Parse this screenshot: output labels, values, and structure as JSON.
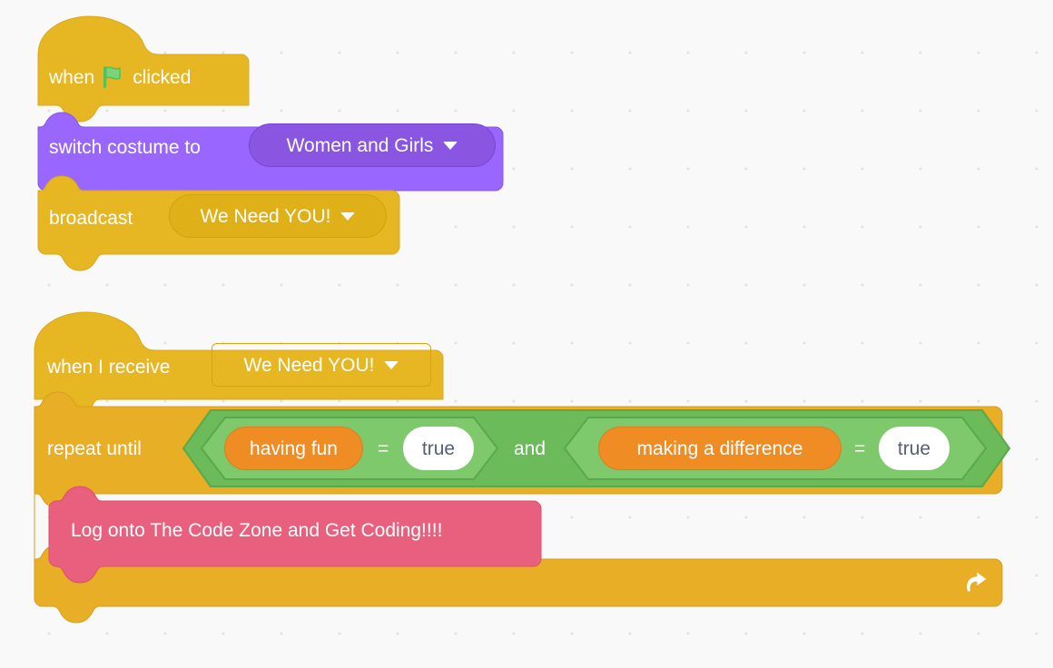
{
  "workspace": {
    "name": "scratch-block-workspace",
    "background_color": "#f9f9f9",
    "grid_dot_color": "#e3e3e6"
  },
  "palette": {
    "events_yellow": "#ffbf00",
    "events_yellow_fill": "#e6b723",
    "looks_purple": "#9966ff",
    "control_orange": "#e8ae25",
    "operators_green": "#6cbb5a",
    "operators_green_light": "#7fc96d",
    "variables_orange": "#ef8c24",
    "custom_pink": "#e8607d",
    "text_white": "#ffffff",
    "text_dark": "#575e75"
  },
  "scripts": [
    {
      "id": "script-1",
      "blocks": [
        {
          "id": "when-flag-clicked",
          "type": "hat",
          "category": "events",
          "label_before": "when",
          "icon": "green-flag-icon",
          "label_after": "clicked"
        },
        {
          "id": "switch-costume-to",
          "type": "stack",
          "category": "looks",
          "label": "switch costume to",
          "field": {
            "name": "costume-dropdown",
            "value": "Women and Girls",
            "kind": "dropdown"
          }
        },
        {
          "id": "broadcast",
          "type": "stack",
          "category": "events",
          "label": "broadcast",
          "field": {
            "name": "broadcast-message-dropdown",
            "value": "We Need YOU!",
            "kind": "dropdown"
          }
        }
      ]
    },
    {
      "id": "script-2",
      "blocks": [
        {
          "id": "when-i-receive",
          "type": "hat",
          "category": "events",
          "label": "when I receive",
          "field": {
            "name": "receive-message-dropdown",
            "value": "We Need YOU!",
            "kind": "dropdown"
          }
        },
        {
          "id": "repeat-until",
          "type": "c-block",
          "category": "control",
          "label": "repeat until",
          "loop_icon": "loop-arrow-icon",
          "condition": {
            "id": "and-operator",
            "type": "boolean",
            "category": "operators",
            "operator_label": "and",
            "operands": [
              {
                "id": "equals-operator-1",
                "type": "boolean",
                "operator_label": "=",
                "left": {
                  "name": "variable-having-fun",
                  "kind": "variable",
                  "value": "having fun"
                },
                "right": {
                  "name": "value-true-1",
                  "kind": "text-input",
                  "value": "true"
                }
              },
              {
                "id": "equals-operator-2",
                "type": "boolean",
                "operator_label": "=",
                "left": {
                  "name": "variable-making-a-difference",
                  "kind": "variable",
                  "value": "making a difference"
                },
                "right": {
                  "name": "value-true-2",
                  "kind": "text-input",
                  "value": "true"
                }
              }
            ]
          },
          "body": [
            {
              "id": "custom-say-block",
              "type": "stack",
              "category": "custom",
              "label": "Log onto The Code Zone and Get Coding!!!!"
            }
          ]
        }
      ]
    }
  ]
}
